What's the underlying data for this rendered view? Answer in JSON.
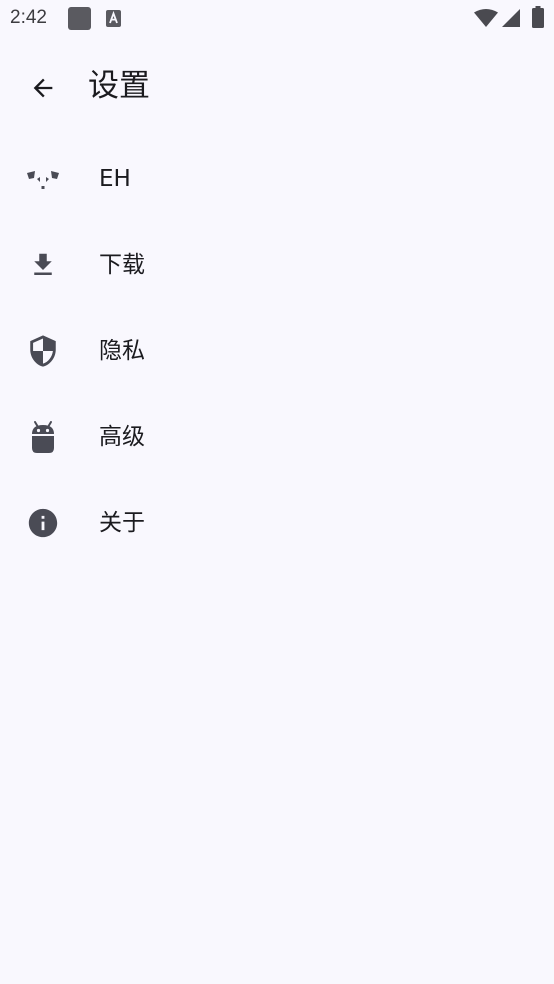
{
  "status_bar": {
    "time": "2:42",
    "icons": [
      "square-notification-icon",
      "keyboard-a-icon",
      "wifi-icon",
      "cellular-signal-icon",
      "battery-icon"
    ]
  },
  "app_bar": {
    "title": "设置",
    "back_icon": "arrow-back-icon"
  },
  "settings": {
    "items": [
      {
        "label": "EH",
        "icon": "panda-icon"
      },
      {
        "label": "下载",
        "icon": "download-icon"
      },
      {
        "label": "隐私",
        "icon": "shield-icon"
      },
      {
        "label": "高级",
        "icon": "android-icon"
      },
      {
        "label": "关于",
        "icon": "info-icon"
      }
    ]
  },
  "colors": {
    "background": "#f9f8fe",
    "icon": "#4a4b55",
    "text": "#1b1b1f"
  }
}
